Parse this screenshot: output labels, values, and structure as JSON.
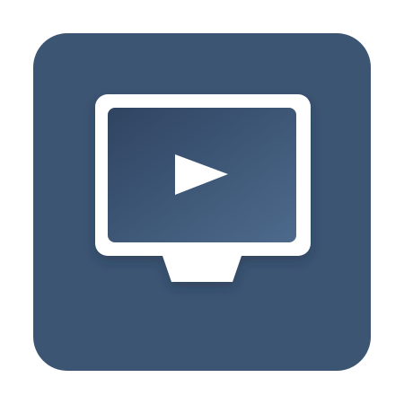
{
  "app_icon": {
    "name": "video-display-app-icon",
    "icon": "monitor-play-icon",
    "colors": {
      "tile_background": "#3c5573",
      "frame": "#ffffff",
      "screen_gradient_start": "#2f4461",
      "screen_gradient_end": "#4d6a8c",
      "play_triangle": "#ffffff"
    }
  }
}
